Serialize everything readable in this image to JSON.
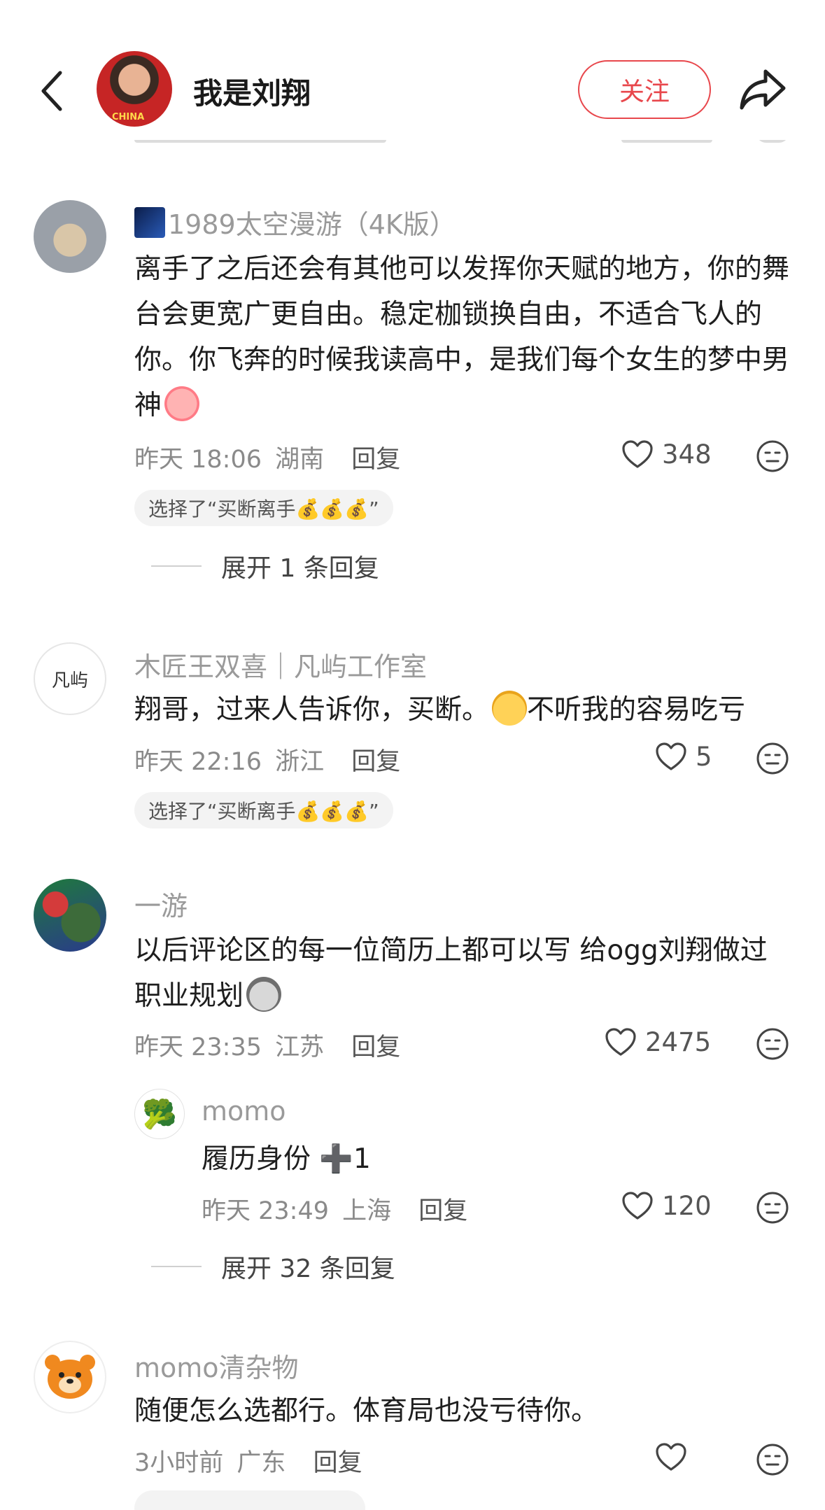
{
  "header": {
    "back_icon": "chevron-left-icon",
    "author_name": "我是刘翔",
    "avatar_jersey": "CHINA",
    "follow_label": "关注",
    "share_icon": "share-arrow-icon",
    "accent_color": "#e8474c"
  },
  "comments": [
    {
      "username": "1989太空漫游（4K版）",
      "text": "离手了之后还会有其他可以发挥你天赋的地方，你的舞台会更宽广更自由。稳定枷锁换自由，不适合飞人的你。你飞奔的时候我读高中，是我们每个女生的梦中男神",
      "time": "昨天 18:06",
      "location": "湖南",
      "reply_label": "回复",
      "likes": "348",
      "choice": "选择了“买断离手💰💰💰”",
      "expand_label": "展开 1 条回复"
    },
    {
      "username": "木匠王双喜｜凡屿工作室",
      "avatar_label": "凡屿",
      "text": "翔哥，过来人告诉你，买断。",
      "text_tail": "不听我的容易吃亏",
      "time": "昨天 22:16",
      "location": "浙江",
      "reply_label": "回复",
      "likes": "5",
      "choice": "选择了“买断离手💰💰💰”"
    },
    {
      "username": "一游",
      "text": "以后评论区的每一位简历上都可以写 给ogg刘翔做过职业规划",
      "time": "昨天 23:35",
      "location": "江苏",
      "reply_label": "回复",
      "likes": "2475",
      "reply": {
        "username": "momo",
        "avatar_emoji": "🥦",
        "text": "履历身份 ➕1",
        "time": "昨天 23:49",
        "location": "上海",
        "reply_label": "回复",
        "likes": "120"
      },
      "expand_label": "展开 32 条回复"
    },
    {
      "username": "momo清杂物",
      "text": "随便怎么选都行。体育局也没亏待你。",
      "time": "3小时前",
      "location": "广东",
      "reply_label": "回复",
      "likes": ""
    }
  ]
}
